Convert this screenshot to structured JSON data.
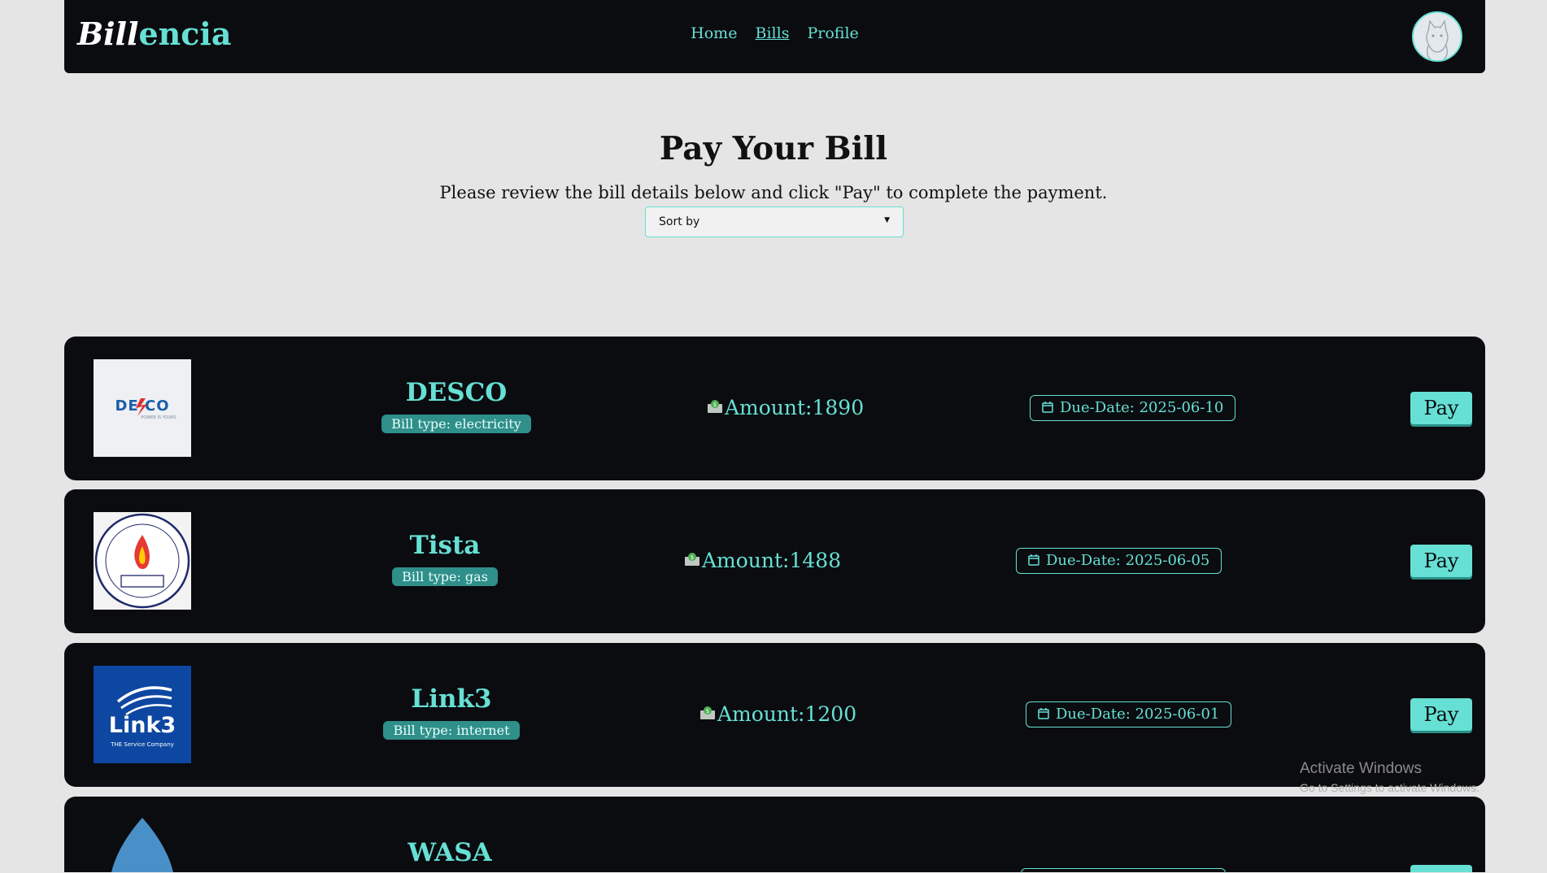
{
  "nav": {
    "brand_part1": "Bill",
    "brand_part2": "encia",
    "links": [
      "Home",
      "Bills",
      "Profile"
    ],
    "active_link": "Bills"
  },
  "page": {
    "title": "Pay Your Bill",
    "subtitle": "Please review the bill details below and click \"Pay\" to complete the payment.",
    "sort_label": "Sort by"
  },
  "bills": [
    {
      "name": "DESCO",
      "type_label": "Bill type: electricity",
      "amount_label": "Amount:1890",
      "due_label": "Due-Date: 2025-06-10",
      "pay_label": "Pay",
      "logo": "desco-logo"
    },
    {
      "name": "Tista",
      "type_label": "Bill type: gas",
      "amount_label": "Amount:1488",
      "due_label": "Due-Date: 2025-06-05",
      "pay_label": "Pay",
      "logo": "titas-gas-logo"
    },
    {
      "name": "Link3",
      "type_label": "Bill type: internet",
      "amount_label": "Amount:1200",
      "due_label": "Due-Date: 2025-06-01",
      "pay_label": "Pay",
      "logo": "link3-logo",
      "logo_text": "Link3",
      "logo_subtext": "THE Service Company"
    },
    {
      "name": "WASA",
      "type_label": "",
      "amount_label": "",
      "due_label": "",
      "pay_label": "",
      "logo": "water-drop-logo"
    }
  ],
  "watermark": {
    "line1": "Activate Windows",
    "line2": "Go to Settings to activate Windows."
  },
  "colors": {
    "accent": "#66e0d4",
    "card_bg": "#0b0c10",
    "page_bg": "#e5e5e5",
    "badge_bg": "#2f8f8a"
  },
  "icons": {
    "amount": "money-envelope-icon",
    "due": "calendar-icon",
    "sort": "caret-down-icon",
    "avatar": "cat-avatar"
  }
}
